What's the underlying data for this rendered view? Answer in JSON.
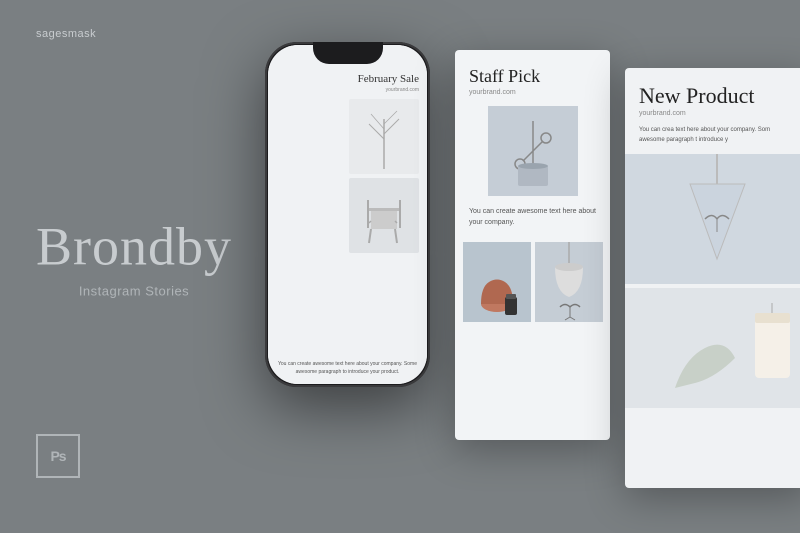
{
  "brand": {
    "label": "sagesmask"
  },
  "left": {
    "main_title": "Brondby",
    "subtitle": "Instagram Stories"
  },
  "ps_badge": {
    "label": "Ps"
  },
  "phone": {
    "story_title": "February Sale",
    "brand_url": "yourbrand.com",
    "text": "You can create awesome text here about your company. Some awesome paragraph to introduce your product."
  },
  "story_card_1": {
    "title": "Staff Pick",
    "url": "yourbrand.com",
    "text": "You can create awesome text here about your company."
  },
  "story_card_2": {
    "title": "New Product",
    "url": "yourbrand.com",
    "text": "You can crea text here about your company. Som awesome paragraph t introduce y"
  },
  "colors": {
    "background": "#7a7f82",
    "card_bg": "#f2f4f6",
    "text_primary": "#222222",
    "text_muted": "#888888",
    "brand_label": "#c8cccf"
  }
}
